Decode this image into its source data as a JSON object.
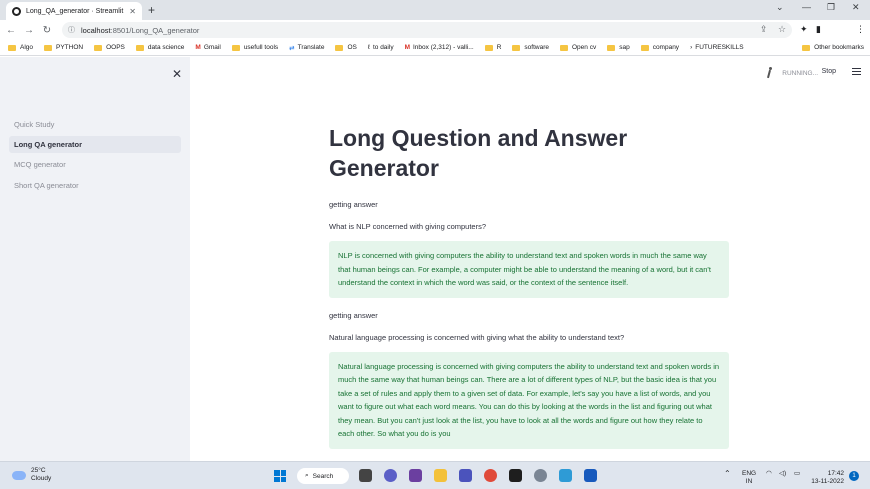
{
  "browser": {
    "tab_title": "Long_QA_generator · Streamlit",
    "url_host": "localhost",
    "url_path": ":8501/Long_QA_generator",
    "bookmarks": [
      "Algo",
      "PYTHON",
      "OOPS",
      "data science",
      "Gmail",
      "usefull tools",
      "Translate",
      "OS",
      "to daily",
      "Inbox (2,312) - valli...",
      "R",
      "software",
      "Open cv",
      "sap",
      "company",
      "FUTURESKILLS"
    ],
    "other_bookmarks": "Other bookmarks"
  },
  "sidebar": {
    "items": [
      {
        "label": "Quick Study",
        "active": false
      },
      {
        "label": "Long QA generator",
        "active": true
      },
      {
        "label": "MCQ generator",
        "active": false
      },
      {
        "label": "Short QA generator",
        "active": false
      }
    ]
  },
  "header": {
    "status": "RUNNING...",
    "stop_label": "Stop"
  },
  "main": {
    "title": "Long Question and Answer Generator",
    "blocks": [
      {
        "status_text": "getting answer",
        "question": "What is NLP concerned with giving computers?",
        "answer": "NLP is concerned with giving computers the ability to understand text and spoken words in much the same way that human beings can. For example, a computer might be able to understand the meaning of a word, but it can't understand the context in which the word was said, or the context of the sentence itself."
      },
      {
        "status_text": "getting answer",
        "question": "Natural language processing is concerned with giving what the ability to understand text?",
        "answer": "Natural language processing is concerned with giving computers the ability to understand text and spoken words in much the same way that human beings can. There are a lot of different types of NLP, but the basic idea is that you take a set of rules and apply them to a given set of data. For example, let's say you have a list of words, and you want to figure out what each word means. You can do this by looking at the words in the list and figuring out what they mean. But you can't just look at the list, you have to look at all the words and figure out how they relate to each other. So what you do is you"
      }
    ]
  },
  "taskbar": {
    "temperature": "25°C",
    "weather": "Cloudy",
    "search_label": "Search",
    "lang_top": "ENG",
    "lang_bottom": "IN",
    "time": "17:42",
    "date": "13-11-2022",
    "notifications": "1"
  },
  "colors": {
    "sidebar_bg": "#f0f2f6",
    "answer_bg": "#e5f5eb",
    "answer_text": "#177233",
    "text": "#31333f"
  }
}
